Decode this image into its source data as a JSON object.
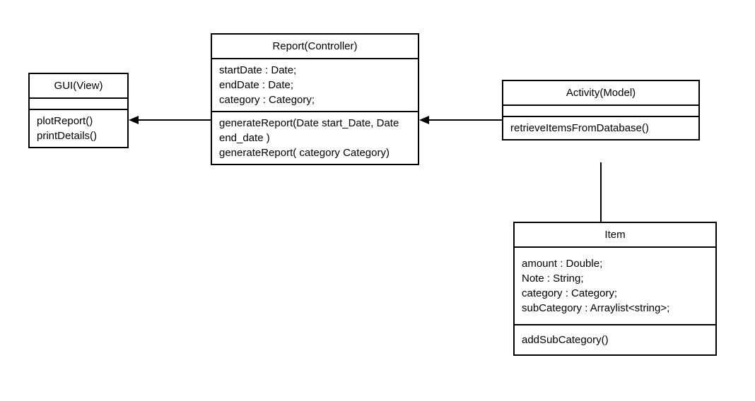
{
  "classes": {
    "gui": {
      "title": "GUI(View)",
      "attributes": [],
      "methods": [
        "plotReport()",
        "printDetails()"
      ]
    },
    "report": {
      "title": "Report(Controller)",
      "attributes": [
        "startDate : Date;",
        "endDate : Date;",
        "category : Category;"
      ],
      "methods": [
        "generateReport(Date start_Date, Date end_date )",
        "generateReport( category Category)"
      ]
    },
    "activity": {
      "title": "Activity(Model)",
      "attributes": [],
      "methods": [
        "retrieveItemsFromDatabase()"
      ]
    },
    "item": {
      "title": "Item",
      "attributes": [
        "amount : Double;",
        "Note : String;",
        "category : Category;",
        "subCategory : Arraylist<string>;"
      ],
      "methods": [
        "addSubCategory()"
      ]
    }
  }
}
